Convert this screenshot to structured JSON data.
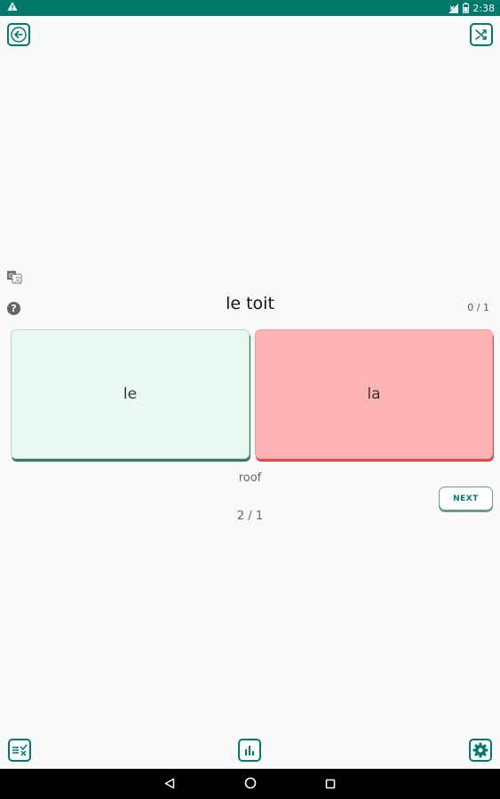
{
  "status_bar": {
    "time": "2:38",
    "icons": [
      "warning-icon",
      "signal-icon",
      "battery-icon"
    ]
  },
  "toolbar": {
    "back_icon": "arrow-left-icon",
    "shuffle_icon": "shuffle-icon"
  },
  "quiz": {
    "word": "le toit",
    "score": "0 / 1",
    "help_symbol": "?",
    "options": [
      "le",
      "la"
    ],
    "translation": "roof",
    "next_label": "NEXT",
    "progress": "2 / 1"
  },
  "bottom_bar": {
    "icons": [
      "check-list-icon",
      "bar-chart-icon",
      "settings-gear-icon"
    ]
  },
  "colors": {
    "accent": "#00796b",
    "correct_bg": "#e8f9f1",
    "wrong_bg": "#ffb4b4"
  }
}
